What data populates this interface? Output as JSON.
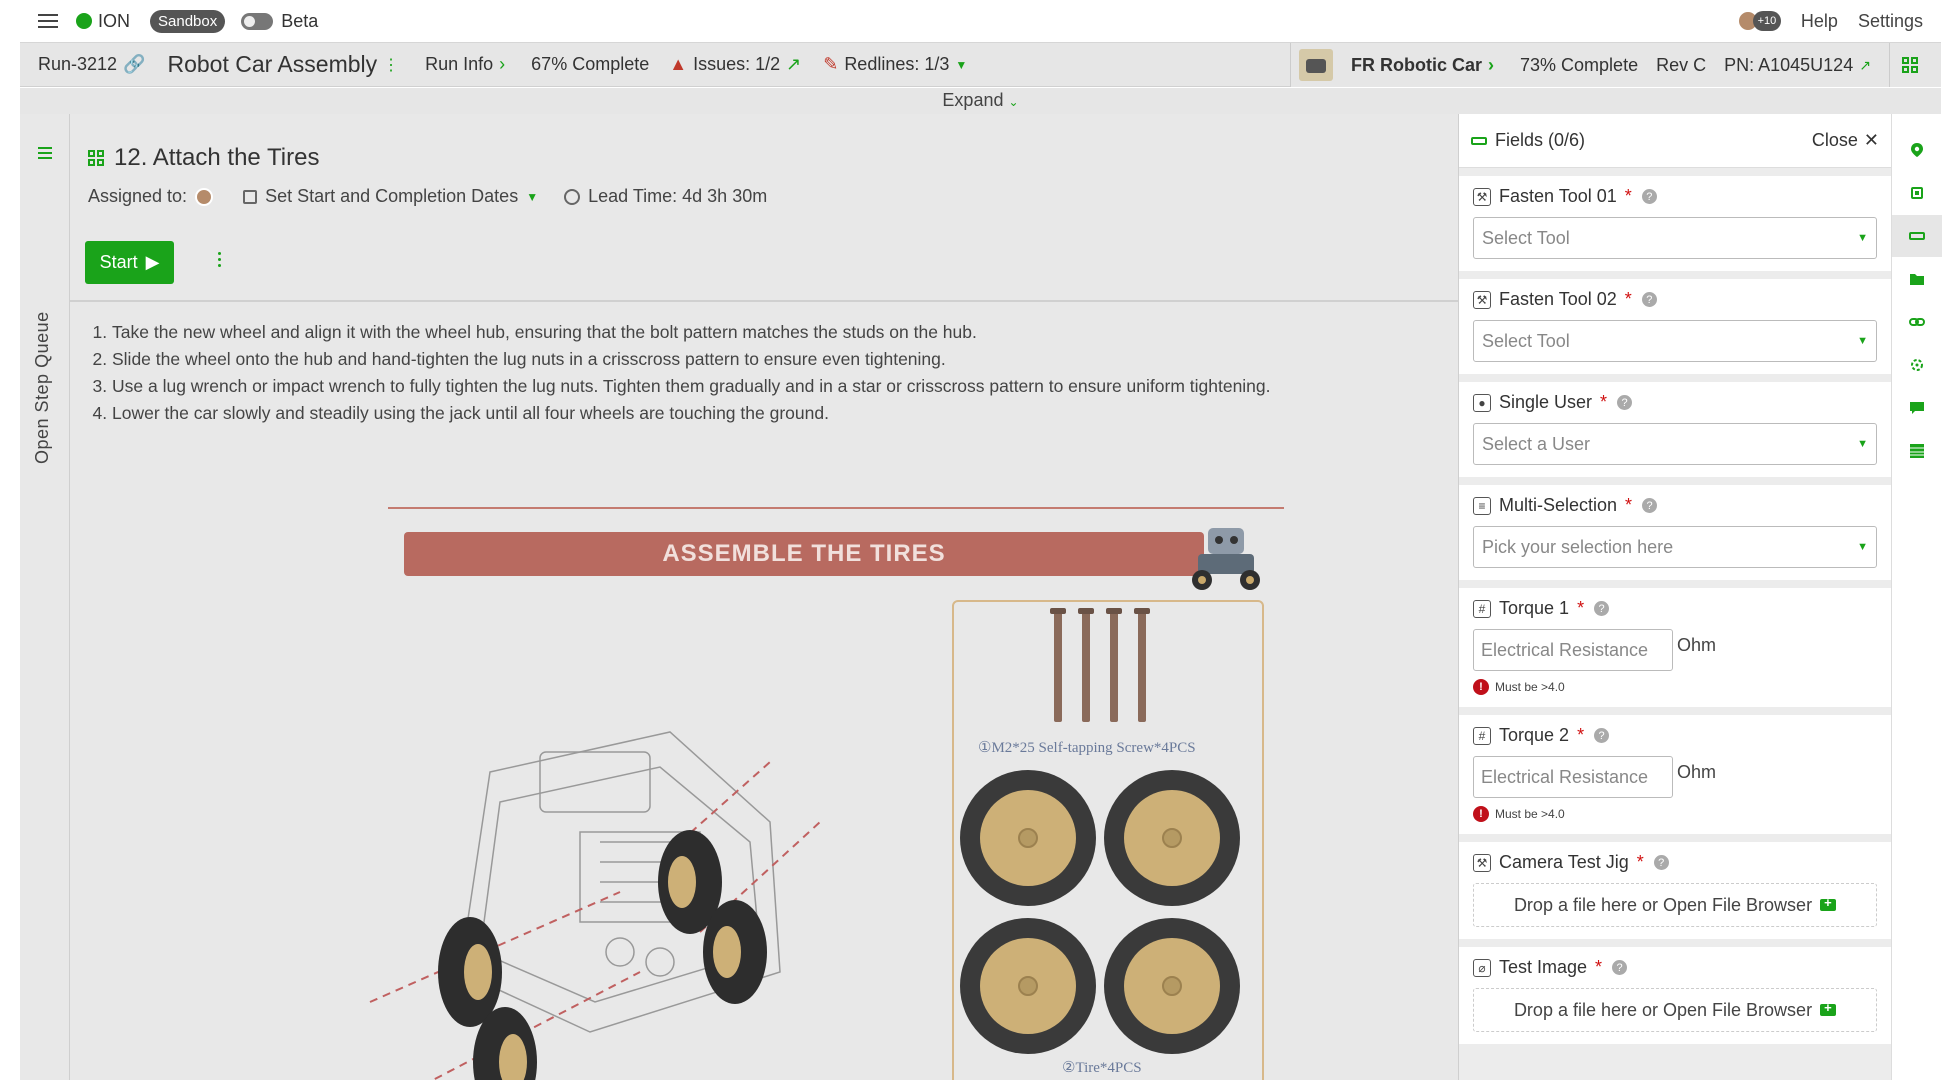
{
  "topbar": {
    "app_name": "ION",
    "env_badge": "Sandbox",
    "beta_label": "Beta",
    "avatar_overflow": "+10",
    "help_label": "Help",
    "settings_label": "Settings"
  },
  "run": {
    "id": "Run-3212",
    "title": "Robot Car Assembly",
    "run_info_label": "Run Info",
    "complete": "67% Complete",
    "issues": "Issues: 1/2",
    "redlines": "Redlines: 1/3",
    "product": {
      "name": "FR Robotic Car",
      "complete": "73% Complete",
      "rev": "Rev C",
      "pn": "PN: A1045U124"
    },
    "expand_label": "Expand"
  },
  "rail": {
    "label": "Open Step Queue"
  },
  "step": {
    "title": "12. Attach the Tires",
    "assigned_label": "Assigned to:",
    "dates_label": "Set Start and Completion Dates",
    "lead_time": "Lead Time: 4d 3h 30m",
    "start_label": "Start",
    "instructions": [
      "Take the new wheel and align it with the wheel hub, ensuring that the bolt pattern matches the studs on the hub.",
      "Slide the wheel onto the hub and hand-tighten the lug nuts in a crisscross pattern to ensure even tightening.",
      "Use a lug wrench or impact wrench to fully tighten the lug nuts. Tighten them gradually and in a star or crisscross pattern to ensure uniform tightening.",
      "Lower the car slowly and steadily using the jack until all four wheels are touching the ground."
    ]
  },
  "illustration": {
    "banner": "ASSEMBLE THE TIRES",
    "screw_caption": "①M2*25 Self-tapping Screw*4PCS",
    "tire_caption": "②Tire*4PCS"
  },
  "drawer": {
    "title": "Fields (0/6)",
    "close_label": "Close",
    "fields": [
      {
        "label": "Fasten Tool 01",
        "placeholder": "Select Tool"
      },
      {
        "label": "Fasten Tool 02",
        "placeholder": "Select Tool"
      },
      {
        "label": "Single User",
        "placeholder": "Select a User"
      },
      {
        "label": "Multi-Selection",
        "placeholder": "Pick your selection here"
      },
      {
        "label": "Torque 1",
        "placeholder": "Electrical Resistance",
        "unit": "Ohm",
        "error": "Must be >4.0"
      },
      {
        "label": "Torque 2",
        "placeholder": "Electrical Resistance",
        "unit": "Ohm",
        "error": "Must be >4.0"
      },
      {
        "label": "Camera Test Jig",
        "drop": "Drop a file here or Open File Browser"
      },
      {
        "label": "Test Image",
        "drop": "Drop a file here or Open File Browser"
      }
    ],
    "required_mark": "*"
  },
  "colors": {
    "accent": "#1aa31a",
    "danger": "#c0101a"
  }
}
